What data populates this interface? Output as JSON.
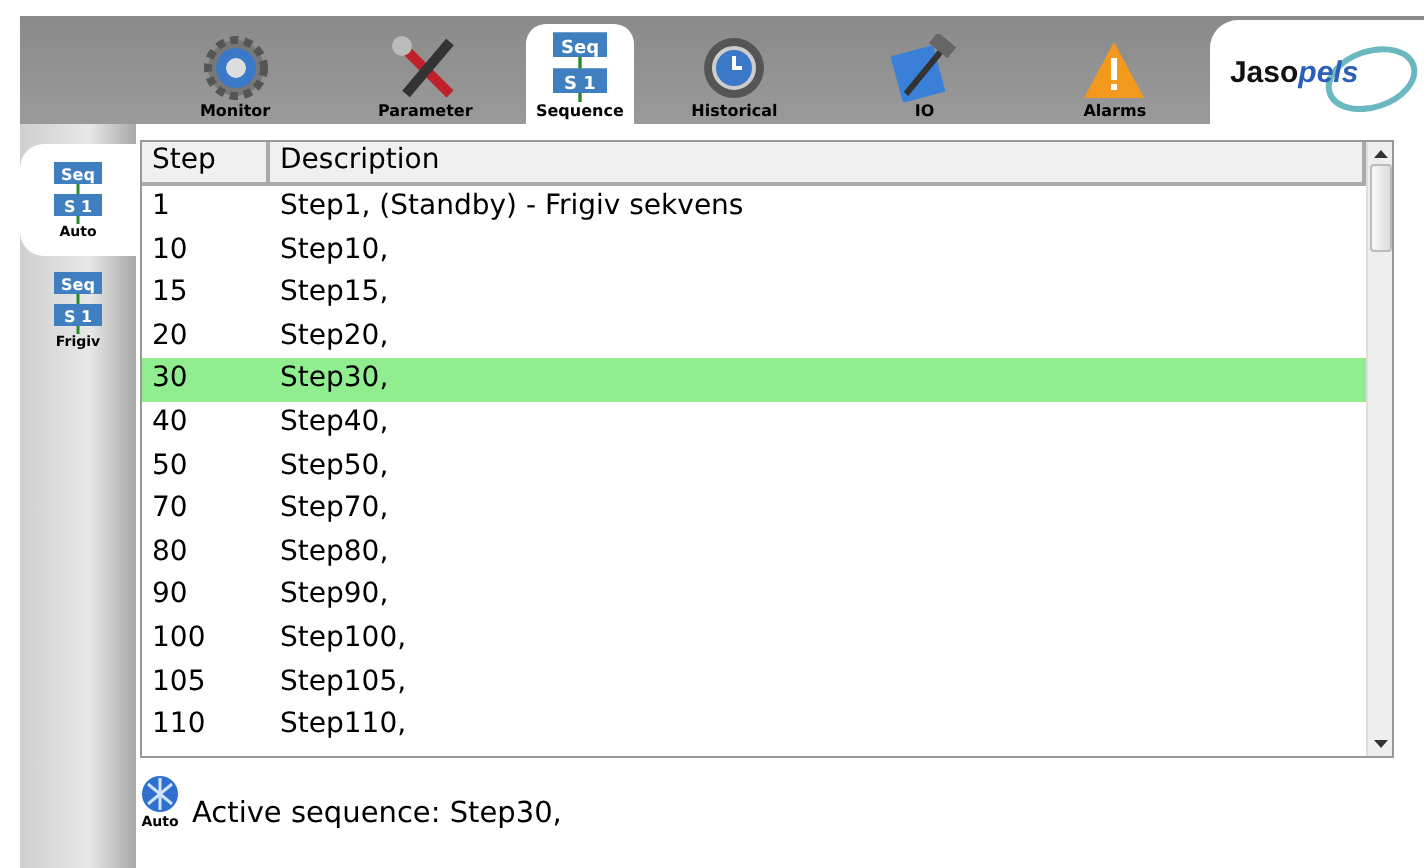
{
  "top_tabs": [
    {
      "label": "Monitor",
      "kind": "gear",
      "selected": false
    },
    {
      "label": "Parameter",
      "kind": "tools",
      "selected": false
    },
    {
      "label": "Sequence",
      "kind": "sequence",
      "selected": true,
      "icon_text": [
        "Seq",
        "S 1"
      ]
    },
    {
      "label": "Historical",
      "kind": "clock",
      "selected": false
    },
    {
      "label": "IO",
      "kind": "hammer",
      "selected": false
    },
    {
      "label": "Alarms",
      "kind": "warning",
      "selected": false
    }
  ],
  "logo": {
    "part_1": "Jaso",
    "part_2": "pels"
  },
  "side_tabs": [
    {
      "label": "Auto",
      "selected": true,
      "icon_text": [
        "Seq",
        "S 1"
      ]
    },
    {
      "label": "Frigiv",
      "selected": false,
      "icon_text": [
        "Seq",
        "S 1"
      ]
    }
  ],
  "table": {
    "columns": [
      "Step",
      "Description"
    ],
    "rows": [
      {
        "step": "1",
        "description": "Step1, (Standby) - Frigiv sekvens",
        "selected": false
      },
      {
        "step": "10",
        "description": "Step10,",
        "selected": false
      },
      {
        "step": "15",
        "description": "Step15,",
        "selected": false
      },
      {
        "step": "20",
        "description": "Step20,",
        "selected": false
      },
      {
        "step": "30",
        "description": "Step30,",
        "selected": true
      },
      {
        "step": "40",
        "description": "Step40,",
        "selected": false
      },
      {
        "step": "50",
        "description": "Step50,",
        "selected": false
      },
      {
        "step": "70",
        "description": "Step70,",
        "selected": false
      },
      {
        "step": "80",
        "description": "Step80,",
        "selected": false
      },
      {
        "step": "90",
        "description": "Step90,",
        "selected": false
      },
      {
        "step": "100",
        "description": "Step100,",
        "selected": false
      },
      {
        "step": "105",
        "description": "Step105,",
        "selected": false
      },
      {
        "step": "110",
        "description": "Step110,",
        "selected": false
      }
    ]
  },
  "status_bar": {
    "mode": "Auto",
    "text": "Active sequence: Step30,"
  }
}
